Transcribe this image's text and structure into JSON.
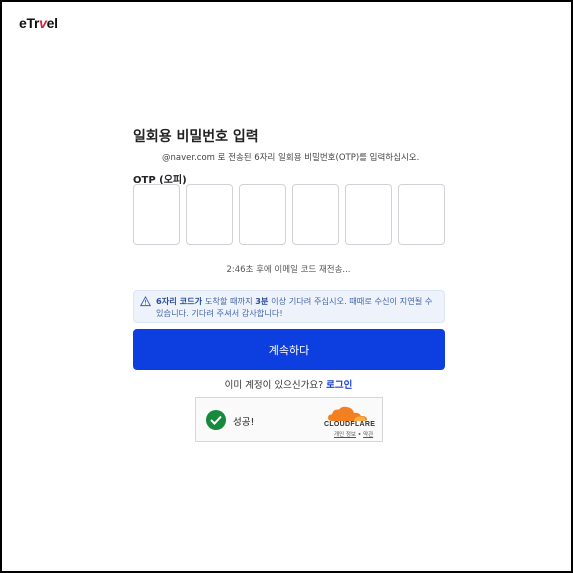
{
  "header": {
    "logo_prefix": "eTr",
    "logo_accent": "v",
    "logo_suffix": "el"
  },
  "form": {
    "title": "일회용 비밀번호 입력",
    "subtitle": "@naver.com 로 전송된 6자리 일회용 비밀번호(OTP)를 입력하십시오.",
    "otp_label": "OTP (오피)",
    "otp_digits": [
      "",
      "",
      "",
      "",
      "",
      ""
    ],
    "resend_text": "2:46초 후에 이메일 코드 재전송...",
    "notice_bold1": "6자리 코드가",
    "notice_mid1": " 도착할 때까지 ",
    "notice_bold2": "3분",
    "notice_rest": " 이상 기다려 주십시오. 때때로 수신이 지연될 수 있습니다. 기다려 주셔서 감사합니다!",
    "continue_label": "계속하다",
    "has_account_text": "이미 계정이 있으신가요? ",
    "login_label": "로그인"
  },
  "captcha": {
    "status": "성공!",
    "brand": "CLOUDFLARE",
    "privacy_label": "개인 정보",
    "separator": "•",
    "terms_label": "약관"
  },
  "colors": {
    "primary_button": "#0d3ee0",
    "logo_accent": "#d21f3c",
    "success_green": "#168a3c",
    "cloudflare_orange": "#f38020"
  }
}
